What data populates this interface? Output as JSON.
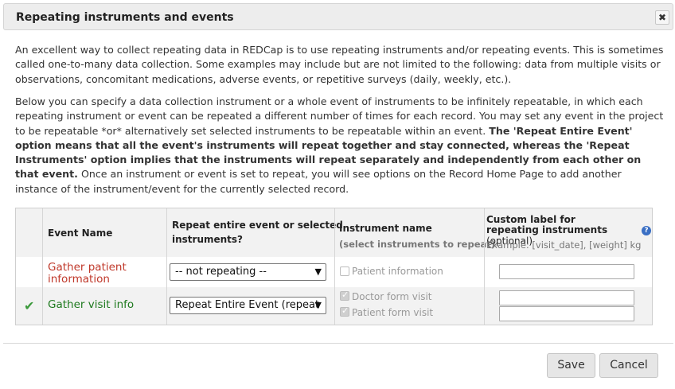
{
  "dialog": {
    "title": "Repeating instruments and events",
    "close_label": "✖"
  },
  "intro": {
    "paragraph1": "An excellent way to collect repeating data in REDCap is to use repeating instruments and/or repeating events. This is sometimes called one-to-many data collection. Some examples may include but are not limited to the following: data from multiple visits or observations, concomitant medications, adverse events, or repetitive surveys (daily, weekly, etc.).",
    "p2_part1": "Below you can specify a data collection instrument or a whole event of instruments to be infinitely repeatable, in which each repeating instrument or event can be repeated a different number of times for each record. You may set any event in the project to be repeatable *or* alternatively set selected instruments to be repeatable within an event. ",
    "p2_bold": "The 'Repeat Entire Event' option means that all the event's instruments will repeat together and stay connected, whereas the 'Repeat Instruments' option implies that the instruments will repeat separately and independently from each other on that event.",
    "p2_part2": " Once an instrument or event is set to repeat, you will see options on the Record Home Page to add another instance of the instrument/event for the currently selected record."
  },
  "table": {
    "headers": {
      "event_name": "Event Name",
      "repeat_col_line1": "Repeat entire event or selected",
      "repeat_col_line2": "instruments?",
      "instrument_name": "Instrument name",
      "instrument_sub": "(select instruments to repeat)",
      "custom_label_line1": "Custom label for",
      "custom_label_line2": "repeating instruments",
      "custom_optional": "(optional)",
      "custom_example": "Example: [visit_date], [weight] kg"
    },
    "rows": [
      {
        "event_line1": "Gather patient",
        "event_line2": "information",
        "repeat_value": "-- not repeating --",
        "instruments": [
          {
            "label": "Patient information",
            "checked": false
          }
        ],
        "status_icon": ""
      },
      {
        "event_line1": "Gather visit info",
        "repeat_value": "Repeat Entire Event (repeat",
        "instruments": [
          {
            "label": "Doctor form visit",
            "checked": true
          },
          {
            "label": "Patient form visit",
            "checked": true
          }
        ],
        "status_icon": "checkmark-icon"
      }
    ]
  },
  "buttons": {
    "save": "Save",
    "cancel": "Cancel"
  },
  "colors": {
    "event_not_repeating": "#c0392b",
    "event_repeating": "#1f7a1f",
    "header_bg": "#ededed"
  }
}
